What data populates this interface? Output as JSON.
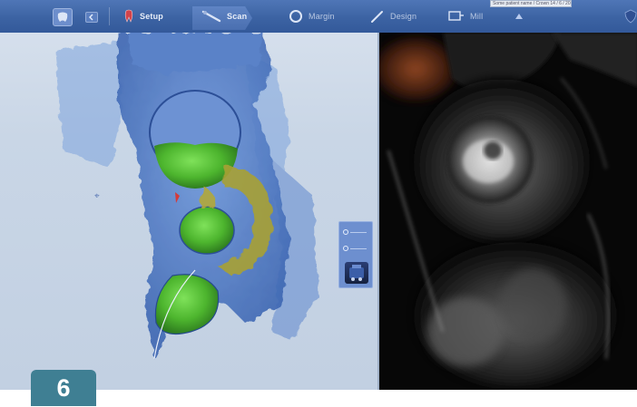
{
  "toolbar": {
    "steps": [
      {
        "label": "Setup",
        "icon": "tooth-icon",
        "active": false
      },
      {
        "label": "Scan",
        "icon": "scanner-wand-icon",
        "active": true
      },
      {
        "label": "Margin",
        "icon": "margin-ring-icon",
        "active": false
      },
      {
        "label": "Design",
        "icon": "pen-icon",
        "active": false
      },
      {
        "label": "Mill",
        "icon": "mill-icon",
        "active": false
      }
    ],
    "field_text": "Some patient name / Crown 14 / 6 / 2022"
  },
  "figure_number": "6",
  "colors": {
    "toolbar": "#3c63a3",
    "model_background": "#c9d6e6",
    "scan_blue": "#4f79c6",
    "prep_green": "#58c03a",
    "margin_yellow": "#a29a33",
    "camera_bg": "#060606",
    "badge": "#3f7f93"
  }
}
